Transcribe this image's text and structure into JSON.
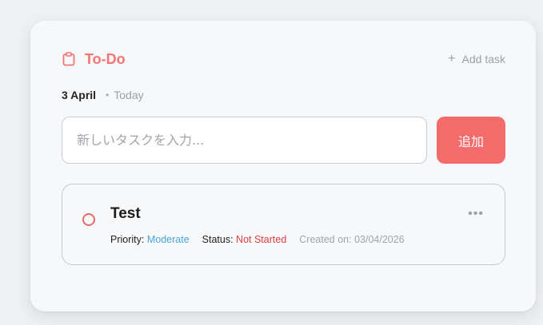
{
  "header": {
    "title": "To-Do",
    "title_icon": "clipboard-icon",
    "add_task_label": "Add task"
  },
  "date_row": {
    "date": "3 April",
    "relative": "Today"
  },
  "new_task": {
    "placeholder": "新しいタスクを入力...",
    "value": "",
    "submit_label": "追加"
  },
  "tasks": [
    {
      "title": "Test",
      "priority_label": "Priority:",
      "priority": "Moderate",
      "status_label": "Status:",
      "status": "Not Started",
      "created": "Created on: 03/04/2026"
    }
  ],
  "colors": {
    "accent": "#f07575",
    "button": "#f46b6b",
    "priority": "#4ba6d6",
    "status": "#e53e3e"
  }
}
